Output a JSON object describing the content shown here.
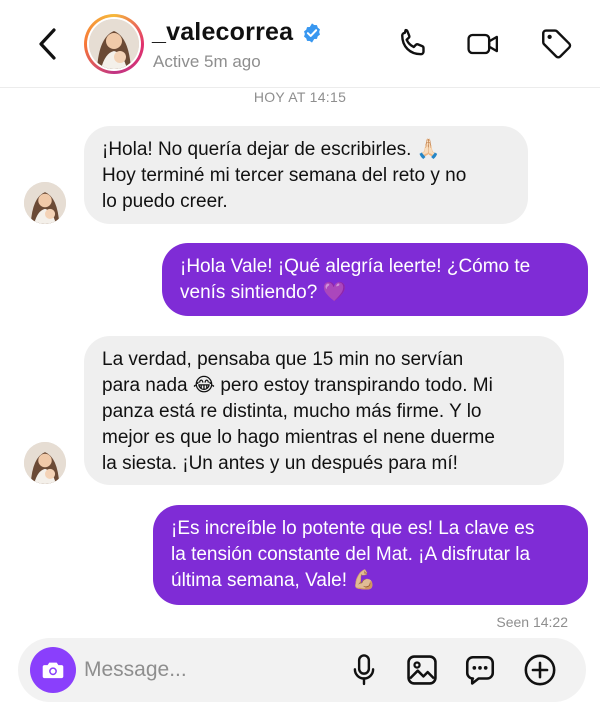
{
  "header": {
    "username": "_valecorrea",
    "status": "Active 5m ago",
    "verified": true,
    "icons": [
      "back-icon",
      "phone-icon",
      "video-icon",
      "tag-icon"
    ]
  },
  "chat": {
    "timestamp": "HOY AT 14:15",
    "messages": [
      {
        "from": "them",
        "lines": [
          "¡Hola! No quería dejar de escribirles. 🙏🏻",
          "Hoy terminé mi tercer semana del reto y no",
          "lo puedo creer."
        ]
      },
      {
        "from": "me",
        "lines": [
          "¡Hola Vale! ¡Qué alegría leerte! ¿Cómo te",
          "venís sintiendo? 💜"
        ]
      },
      {
        "from": "them",
        "lines": [
          "La verdad, pensaba que 15 min no servían",
          "para nada 😂 pero estoy transpirando todo. Mi",
          "panza está re distinta, mucho más firme. Y lo",
          "mejor es que lo hago mientras el nene duerme",
          "la siesta. ¡Un antes y un después para mí!"
        ]
      },
      {
        "from": "me",
        "lines": [
          "¡Es increíble lo potente que es! La clave es",
          "la tensión constante del Mat. ¡A disfrutar la",
          "última semana, Vale! 💪🏼"
        ]
      }
    ],
    "seen": "Seen 14:22"
  },
  "composer": {
    "placeholder": "Message...",
    "value": "",
    "icons": [
      "camera-icon",
      "microphone-icon",
      "image-icon",
      "sticker-icon",
      "plus-icon"
    ]
  },
  "colors": {
    "outgoing_bubble": "#7f2cd6",
    "incoming_bubble": "#efefef",
    "camera_button": "#8a3ffc",
    "verified": "#3897f0"
  }
}
